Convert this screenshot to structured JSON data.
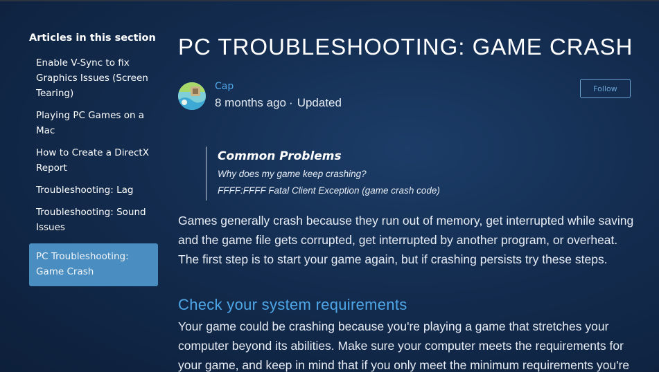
{
  "sidebar": {
    "title": "Articles in this section",
    "items": [
      {
        "label": "Enable V-Sync to fix Graphics Issues (Screen Tearing)"
      },
      {
        "label": "Playing PC Games on a Mac"
      },
      {
        "label": "How to Create a DirectX Report"
      },
      {
        "label": "Troubleshooting: Lag"
      },
      {
        "label": "Troubleshooting: Sound Issues"
      },
      {
        "label": "PC Troubleshooting: Game Crash",
        "active": true
      }
    ]
  },
  "article": {
    "title": "PC TROUBLESHOOTING: GAME CRASH",
    "author": "Cap",
    "posted": "8 months ago",
    "separator": "·",
    "updated": "Updated",
    "follow_label": "Follow",
    "callout": {
      "title": "Common Problems",
      "lines": [
        "Why does my game keep crashing?",
        "FFFF:FFFF Fatal Client Exception (game crash code)"
      ]
    },
    "intro": "Games generally crash because they run out of memory, get interrupted while saving and the  game file gets corrupted, get interrupted by another program, or overheat. The first step is to start your game again, but if crashing persists try these steps.",
    "section_heading": "Check your system requirements",
    "section_text": "Your game could be crashing because you're playing a game that stretches your computer beyond its abilities. Make sure your computer meets the requirements for your game, and keep in mind that if you only meet the minimum requirements you're"
  },
  "colors": {
    "background": "#132c4f",
    "accent": "#4fa7e8",
    "active_nav": "#4a8dc0"
  }
}
